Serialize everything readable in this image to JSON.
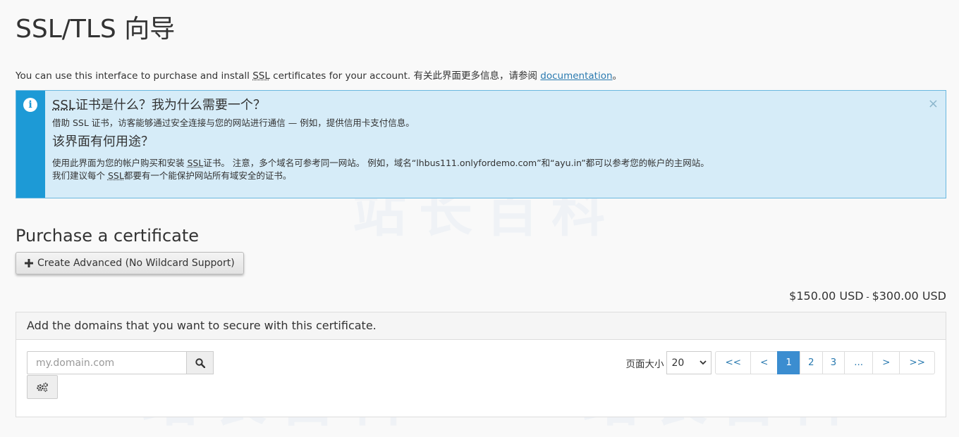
{
  "page": {
    "title": "SSL/TLS 向导",
    "intro_text": "You can use this interface to purchase and install ",
    "intro_abbr": "SSL",
    "intro_text2": " certificates for your account. 有关此界面更多信息，请参阅 ",
    "intro_link": "documentation",
    "intro_end": "。"
  },
  "alert": {
    "q1_abbr": "SSL",
    "q1_rest": "证书是什么？我为什么需要一个？",
    "p1": "借助 SSL 证书，访客能够通过安全连接与您的网站进行通信 — 例如，提供信用卡支付信息。",
    "q2": "该界面有何用途？",
    "p2a_pre": "使用此界面为您的帐户购买和安装 ",
    "p2a_abbr": "SSL",
    "p2a_post": "证书。 注意，多个域名可参考同一网站。 例如，域名“lhbus111.onlyfordemo.com”和“ayu.in”都可以参考您的帐户的主网站。",
    "p2b_pre": "我们建议每个 ",
    "p2b_abbr": "SSL",
    "p2b_post": "都要有一个能保护网站所有域安全的证书。",
    "close": "×"
  },
  "purchase": {
    "heading": "Purchase a certificate",
    "create_button": "Create Advanced (No Wildcard Support)",
    "price_low": "$150.00 USD",
    "price_sep": " - ",
    "price_high": "$300.00 USD"
  },
  "domains": {
    "panel_title": "Add the domains that you want to secure with this certificate.",
    "search_placeholder": "my.domain.com",
    "page_size_label": "页面大小",
    "page_size": "20",
    "pager": [
      "<<",
      "<",
      "1",
      "2",
      "3",
      "...",
      ">",
      ">>"
    ],
    "active_page": "1"
  },
  "watermark": "站长百科",
  "colors": {
    "accent": "#1d9ad6",
    "link": "#2a7ab0",
    "active_page": "#3b8dd0"
  },
  "icons": {
    "info": "info-icon",
    "plus": "plus-icon",
    "search": "search-icon",
    "gear": "gears-icon",
    "dropdown": "chevron-down-icon"
  }
}
